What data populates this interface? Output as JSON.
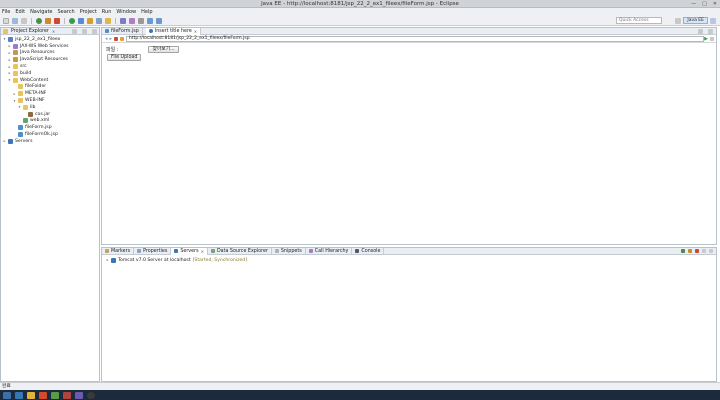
{
  "window": {
    "title": "Java EE - http://localhost:8181/jsp_22_2_ex1_fileex/fileForm.jsp - Eclipse",
    "controls": [
      "—",
      "□",
      "✕"
    ]
  },
  "menu": [
    "File",
    "Edit",
    "Navigate",
    "Search",
    "Project",
    "Run",
    "Window",
    "Help"
  ],
  "toolbar": {
    "quick_access": "Quick Access",
    "perspective": "Java EE"
  },
  "project_explorer": {
    "tab_label": "Project Explorer",
    "tree": [
      {
        "label": "jsp_22_2_ex1_fileex",
        "icon": "project-icon",
        "toggle": "▾",
        "indent": 0
      },
      {
        "label": "JAX-WS Web Services",
        "icon": "web-services-icon",
        "toggle": "▸",
        "indent": 1
      },
      {
        "label": "Java Resources",
        "icon": "java-resources-icon",
        "toggle": "▸",
        "indent": 1
      },
      {
        "label": "JavaScript Resources",
        "icon": "javascript-resources-icon",
        "toggle": "▸",
        "indent": 1
      },
      {
        "label": "src",
        "icon": "folder-icon",
        "toggle": "▸",
        "indent": 1
      },
      {
        "label": "build",
        "icon": "folder-icon",
        "toggle": "▸",
        "indent": 1
      },
      {
        "label": "WebContent",
        "icon": "folder-icon",
        "toggle": "▾",
        "indent": 1
      },
      {
        "label": "fileFolder",
        "icon": "folder-icon",
        "toggle": "",
        "indent": 2
      },
      {
        "label": "META-INF",
        "icon": "folder-icon",
        "toggle": "▸",
        "indent": 2
      },
      {
        "label": "WEB-INF",
        "icon": "folder-icon",
        "toggle": "▾",
        "indent": 2
      },
      {
        "label": "lib",
        "icon": "folder-icon",
        "toggle": "▾",
        "indent": 3
      },
      {
        "label": "cos.jar",
        "icon": "jar-icon",
        "toggle": "",
        "indent": 4
      },
      {
        "label": "web.xml",
        "icon": "xml-file-icon",
        "toggle": "",
        "indent": 3
      },
      {
        "label": "fileForm.jsp",
        "icon": "jsp-file-icon",
        "toggle": "",
        "indent": 2
      },
      {
        "label": "fileFormOk.jsp",
        "icon": "jsp-file-icon",
        "toggle": "",
        "indent": 2
      },
      {
        "label": "Servers",
        "icon": "servers-folder-icon",
        "toggle": "▸",
        "indent": 0
      }
    ]
  },
  "editor": {
    "tabs": [
      {
        "label": "fileForm.jsp",
        "active": false
      },
      {
        "label": "Insert title here",
        "active": true
      }
    ],
    "url": "http://localhost:8181/jsp_22_2_ex1_fileex/fileForm.jsp",
    "form": {
      "file_label": "파일 :",
      "browse_button": "찾아보기...",
      "upload_button": "File Upload"
    }
  },
  "bottom_panel": {
    "tabs": [
      "Markers",
      "Properties",
      "Servers",
      "Data Source Explorer",
      "Snippets",
      "Call Hierarchy",
      "Console"
    ],
    "active_tab": "Servers",
    "server_row": {
      "name": "Tomcat v7.0 Server at localhost",
      "state": "[Started, Synchronized]"
    }
  },
  "status_bar": {
    "text": "완료"
  },
  "colors": {
    "accent": "#3c77b5",
    "pane_header": "#e9eef5",
    "taskbar": "#1b2a3c"
  }
}
